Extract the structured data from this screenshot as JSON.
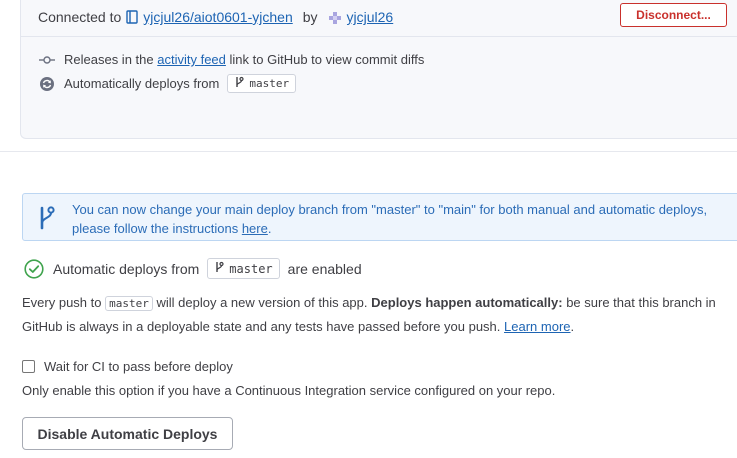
{
  "connection": {
    "connected_to_label": "Connected to",
    "repo_name": "yjcjul26/aiot0601-yjchen",
    "by_label": "by",
    "user_name": "yjcjul26",
    "disconnect_label": "Disconnect..."
  },
  "releases": {
    "prefix": "Releases in the",
    "link": "activity feed",
    "suffix": "link to GitHub to view commit diffs"
  },
  "auto_deploy_info": {
    "prefix": "Automatically deploys from",
    "branch": "master"
  },
  "notice": {
    "text_before": "You can now change your main deploy branch from \"master\" to \"main\" for both manual and automatic deploys, please follow the instructions",
    "link": "here",
    "text_after": "."
  },
  "status": {
    "prefix": "Automatic deploys from",
    "branch": "master",
    "suffix": "are enabled"
  },
  "description": {
    "part1": "Every push to",
    "branch": "master",
    "part2": "will deploy a new version of this app.",
    "bold": "Deploys happen automatically:",
    "part3": "be sure that this branch in GitHub is always in a deployable state and any tests have passed before you push.",
    "link": "Learn more",
    "end": "."
  },
  "ci": {
    "label": "Wait for CI to pass before deploy",
    "checked": false,
    "help": "Only enable this option if you have a Continuous Integration service configured on your repo."
  },
  "disable_button_label": "Disable Automatic Deploys",
  "colors": {
    "link": "#1d64b3",
    "danger": "#c9302c",
    "success": "#3fa34d",
    "notice_bg": "#eef5fd",
    "notice_text": "#2b6cb7"
  },
  "icons": [
    "repo-icon",
    "user-avatar-icon",
    "commit-icon",
    "sync-icon",
    "branch-icon",
    "check-circle-icon"
  ]
}
